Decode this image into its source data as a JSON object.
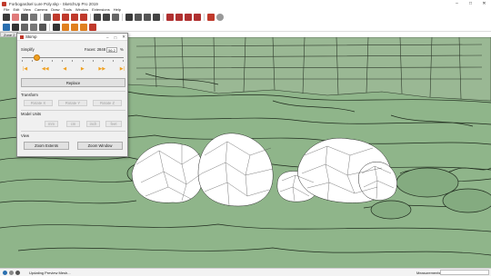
{
  "window": {
    "title": "Forbogardsel Lure Poly.skp - SketchUp Pro 2019",
    "controls": [
      "–",
      "□",
      "✕"
    ]
  },
  "menu": [
    "File",
    "Edit",
    "View",
    "Camera",
    "Draw",
    "Tools",
    "Window",
    "Extensions",
    "Help"
  ],
  "scene_tab": "Zone 2",
  "dialog": {
    "title": "Skimp",
    "controls": [
      "–",
      "□",
      "✕"
    ],
    "simplify_label": "Simplify",
    "faces_label": "Faces: 2848",
    "faces_value": "56.2",
    "percent_symbol": "%",
    "slider_level_percent": 56.2,
    "playback": [
      "|◀",
      "◀◀",
      "◀",
      "▶",
      "▶▶",
      "▶|"
    ],
    "replace_label": "Replace",
    "transform_label": "Transform",
    "transform_buttons": [
      "Rotate X",
      "Rotate Y",
      "Rotate Z"
    ],
    "model_units_label": "Model Units",
    "unit_buttons": [
      "mm",
      "cm",
      "inch",
      "feet"
    ],
    "view_label": "View",
    "zoom_extents_label": "Zoom Extents",
    "zoom_window_label": "Zoom Window"
  },
  "status": {
    "text": "Updating Preview Mesh...",
    "measurements_label": "Measurements"
  },
  "colors": {
    "viewport_bg": "#8fb58a",
    "accent": "#f0a020"
  },
  "toolbar_icons": [
    "select-icon",
    "eraser-icon",
    "pencil-icon",
    "arc-icon",
    "shape-icon",
    "push-pull-icon",
    "move-icon",
    "rotate-icon",
    "scale-icon",
    "tape-icon",
    "text-icon",
    "paint-icon",
    "orbit-icon",
    "pan-icon",
    "zoom-icon",
    "zoom-extents-icon"
  ]
}
